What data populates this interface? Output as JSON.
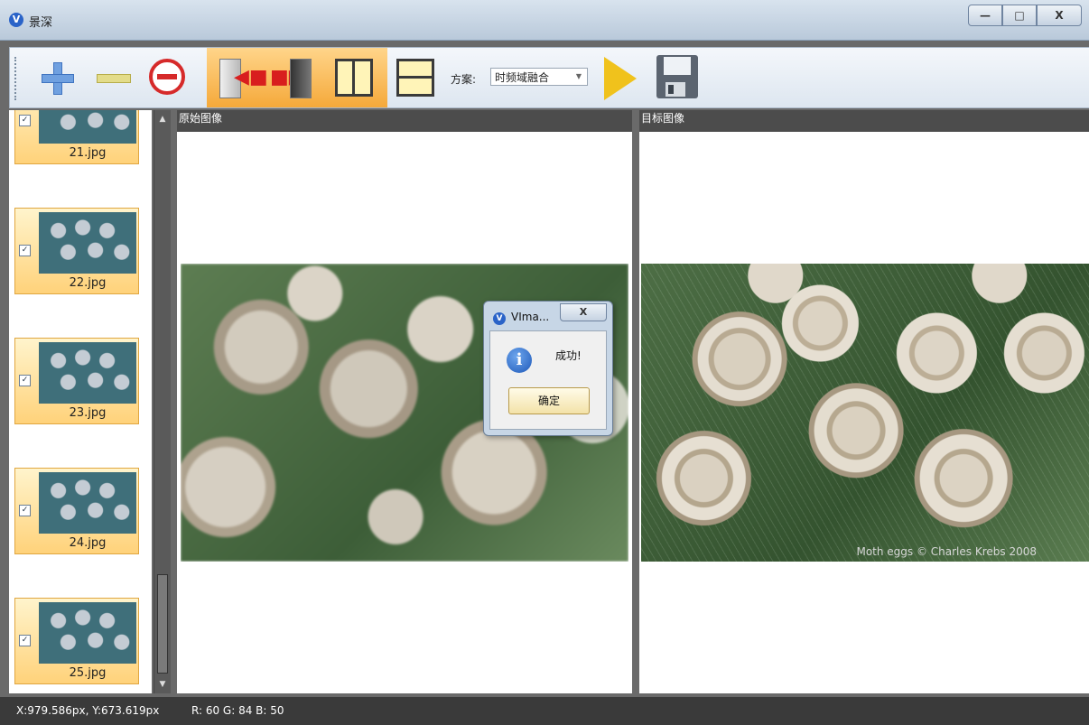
{
  "window": {
    "title": "景深",
    "app_icon": "V",
    "min": "—",
    "max": "□",
    "close": "X"
  },
  "toolbar": {
    "scheme_label": "方案:",
    "scheme_value": "时频域融合",
    "dropdown_glyph": "▼"
  },
  "thumbnails": [
    {
      "name": "21.jpg",
      "checked": "✓"
    },
    {
      "name": "22.jpg",
      "checked": "✓"
    },
    {
      "name": "23.jpg",
      "checked": "✓"
    },
    {
      "name": "24.jpg",
      "checked": "✓"
    },
    {
      "name": "25.jpg",
      "checked": "✓"
    }
  ],
  "panels": {
    "source_title": "原始图像",
    "target_title": "目标图像",
    "watermark": "Moth eggs © Charles Krebs 2008"
  },
  "dialog": {
    "title": "VIma...",
    "close": "X",
    "icon": "i",
    "message": "成功!",
    "ok_label": "确定"
  },
  "status": {
    "coords": "X:979.586px, Y:673.619px",
    "rgb": "R: 60 G: 84 B: 50"
  }
}
